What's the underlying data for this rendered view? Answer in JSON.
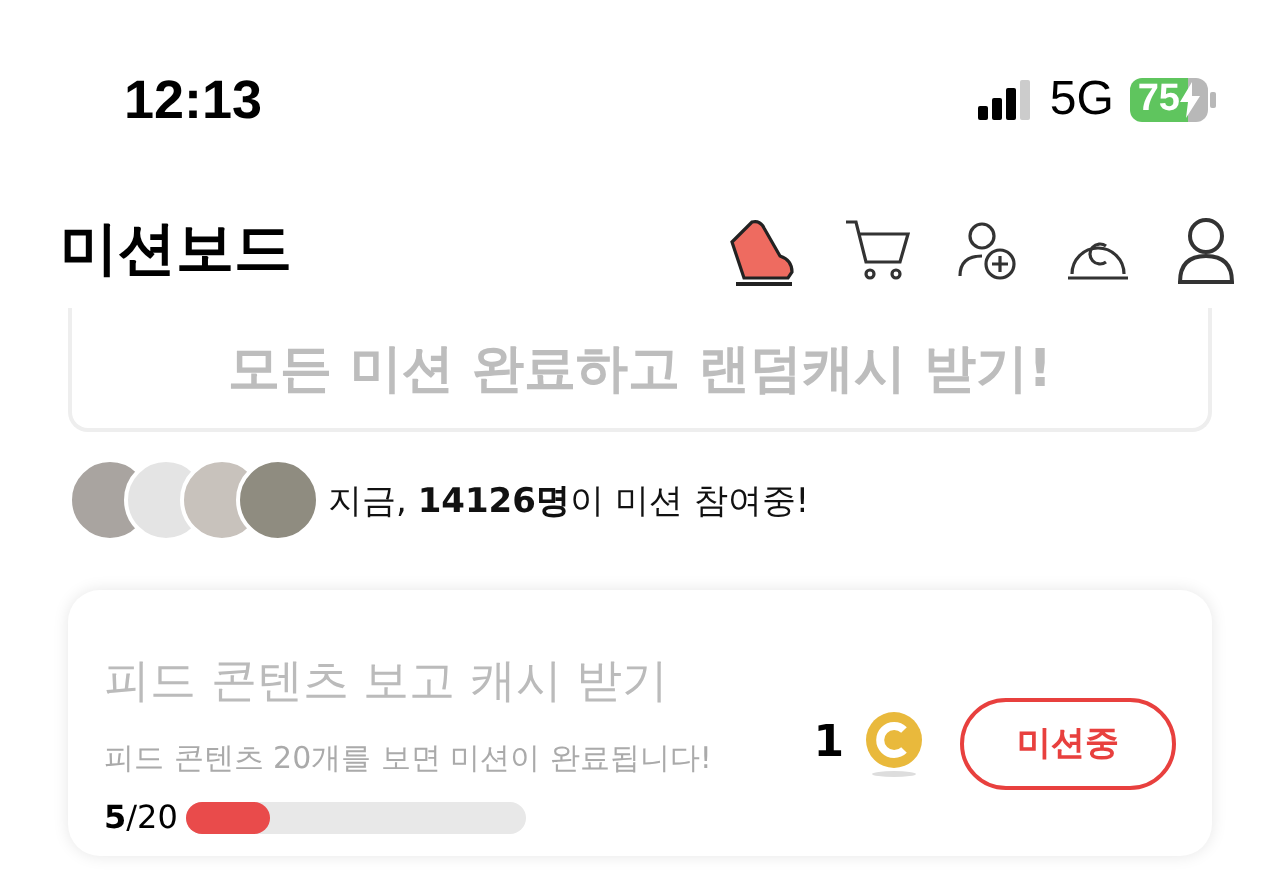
{
  "status_bar": {
    "time": "12:13",
    "network": "5G",
    "battery": "75"
  },
  "header": {
    "title": "미션보드"
  },
  "banner": {
    "text": "모든 미션 완료하고 랜덤캐시 받기!"
  },
  "participants": {
    "text": "지금, **14126명**이 미션 참여중!"
  },
  "missions": [
    {
      "title": "피드 콘텐츠 보고 캐시 받기",
      "description": "피드 콘텐츠 20개를 보면 미션이 완료됩니다!",
      "progress": "**5**/20",
      "level": 0.25,
      "reward": "1",
      "button": "미션중"
    }
  ]
}
